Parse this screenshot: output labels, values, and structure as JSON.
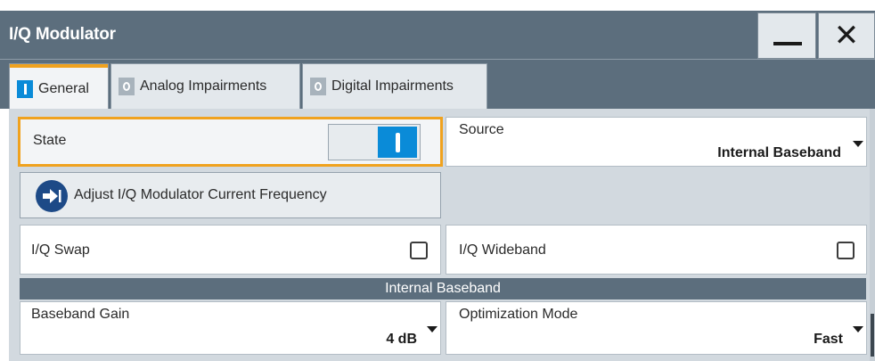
{
  "window": {
    "title": "I/Q Modulator",
    "minimize_symbol": "",
    "close_symbol": "✕"
  },
  "tabs": [
    {
      "label": "General",
      "indicator": "on",
      "active": true
    },
    {
      "label": "Analog Impairments",
      "indicator": "off",
      "active": false
    },
    {
      "label": "Digital Impairments",
      "indicator": "off",
      "active": false
    }
  ],
  "general": {
    "state": {
      "label": "State",
      "on": true
    },
    "source": {
      "label": "Source",
      "value": "Internal Baseband"
    },
    "adjust_button": {
      "label": "Adjust I/Q Modulator Current Frequency"
    },
    "iq_swap": {
      "label": "I/Q Swap",
      "checked": false
    },
    "iq_wideband": {
      "label": "I/Q Wideband",
      "checked": false
    },
    "section_header": "Internal Baseband",
    "baseband_gain": {
      "label": "Baseband Gain",
      "value": "4 dB"
    },
    "optimization_mode": {
      "label": "Optimization Mode",
      "value": "Fast"
    }
  },
  "colors": {
    "titlebar": "#5c6e7d",
    "accent": "#f0a21e",
    "toggle_on": "#0a8bd8",
    "adjust_icon": "#1d4a87"
  }
}
